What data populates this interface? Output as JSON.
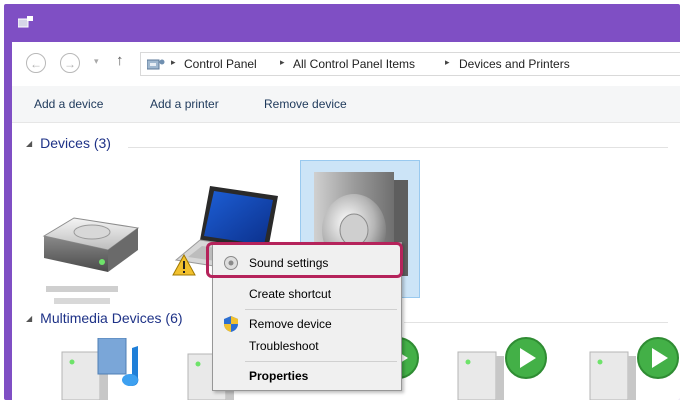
{
  "address": {
    "crumbs": [
      "Control Panel",
      "All Control Panel Items",
      "Devices and Printers"
    ]
  },
  "commands": [
    "Add a device",
    "Add a printer",
    "Remove device"
  ],
  "groups": {
    "devices": {
      "label": "Devices (3)"
    },
    "multimedia": {
      "label": "Multimedia Devices (6)"
    }
  },
  "context_menu": {
    "items": [
      "Sound settings",
      "Create shortcut",
      "Remove device",
      "Troubleshoot",
      "Properties"
    ]
  },
  "colors": {
    "titlebar": "#7f4fc4",
    "highlight_ring": "#b5235b",
    "selection": "#cce4f7",
    "play_green": "#43b047"
  },
  "icons": [
    "back-icon",
    "forward-icon",
    "up-arrow-icon",
    "control-panel-icon",
    "hard-drive-icon",
    "laptop-icon",
    "warning-icon",
    "speaker-icon",
    "sound-settings-icon",
    "shield-icon",
    "media-player-icon",
    "play-icon"
  ]
}
